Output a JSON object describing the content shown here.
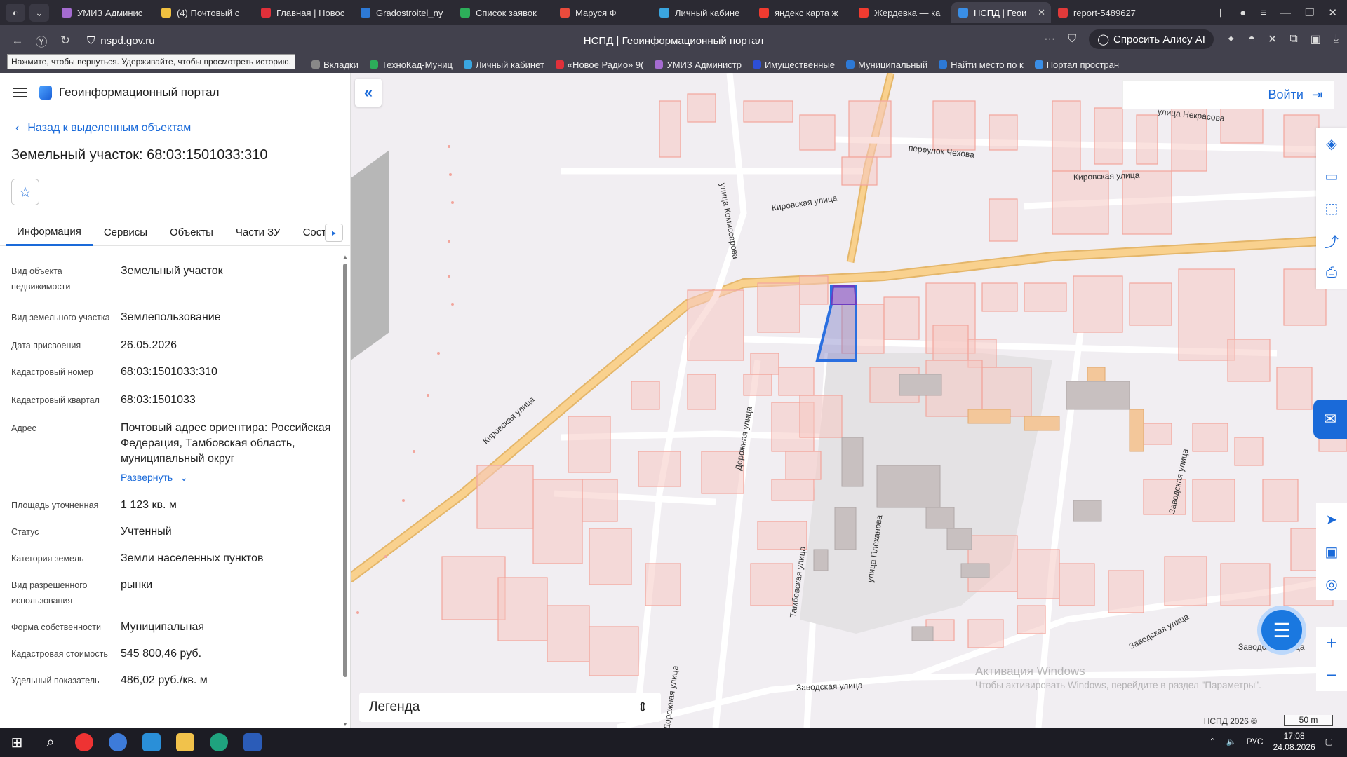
{
  "browser": {
    "tabs": [
      {
        "title": "УМИЗ Админис",
        "color": "#a46bd0",
        "active": false
      },
      {
        "title": "(4) Почтовый с",
        "color": "#f0c040",
        "active": false
      },
      {
        "title": "Главная | Новос",
        "color": "#e0303a",
        "active": false
      },
      {
        "title": "Gradostroitel_ny",
        "color": "#2d79d6",
        "active": false
      },
      {
        "title": "Список заявок",
        "color": "#2dae5a",
        "active": false
      },
      {
        "title": "Маруся Ф",
        "color": "#e94b3c",
        "active": false
      },
      {
        "title": "Личный кабине",
        "color": "#3aa6e0",
        "active": false
      },
      {
        "title": "яндекс карта ж",
        "color": "#f03b30",
        "active": false
      },
      {
        "title": "Жердевка — ка",
        "color": "#f03b30",
        "active": false
      },
      {
        "title": "НСПД | Геои",
        "color": "#3a8ee6",
        "active": true
      },
      {
        "title": "report-5489627",
        "color": "#e03a3a",
        "active": false
      }
    ],
    "url": "nspd.gov.ru",
    "page_title": "НСПД | Геоинформационный портал",
    "alice_label": "Спросить Алису AI",
    "tooltip": "Нажмите, чтобы вернуться. Удерживайте, чтобы просмотреть историю.",
    "bookmarks": [
      {
        "label": "Вкладки",
        "color": "#888"
      },
      {
        "label": "ТехноКад-Муниц",
        "color": "#2dae5a"
      },
      {
        "label": "Личный кабинет",
        "color": "#3aa6e0"
      },
      {
        "label": "«Новое Радио» 9(",
        "color": "#e0303a"
      },
      {
        "label": "УМИЗ Администр",
        "color": "#a46bd0"
      },
      {
        "label": "Имущественные",
        "color": "#2d4fd6"
      },
      {
        "label": "Муниципальный",
        "color": "#2d79d6"
      },
      {
        "label": "Найти место по к",
        "color": "#2d79d6"
      },
      {
        "label": "Портал простран",
        "color": "#3a8ee6"
      }
    ]
  },
  "panel": {
    "portal_name": "Геоинформационный портал",
    "back_label": "Назад к выделенным объектам",
    "object_title": "Земельный участок: 68:03:1501033:310",
    "tabs": [
      "Информация",
      "Сервисы",
      "Объекты",
      "Части ЗУ",
      "Состав"
    ],
    "properties": [
      {
        "label": "Вид объекта недвижимости",
        "value": "Земельный участок"
      },
      {
        "label": "Вид земельного участка",
        "value": "Землепользование"
      },
      {
        "label": "Дата присвоения",
        "value": "26.05.2026"
      },
      {
        "label": "Кадастровый номер",
        "value": "68:03:1501033:310"
      },
      {
        "label": "Кадастровый квартал",
        "value": "68:03:1501033"
      },
      {
        "label": "Адрес",
        "value": "Почтовый адрес ориентира: Российская Федерация, Тамбовская область, муниципальный округ",
        "expand": "Развернуть"
      },
      {
        "label": "Площадь уточненная",
        "value": "1 123 кв. м"
      },
      {
        "label": "Статус",
        "value": "Учтенный"
      },
      {
        "label": "Категория земель",
        "value": "Земли населенных пунктов"
      },
      {
        "label": "Вид разрешенного использования",
        "value": "рынки"
      },
      {
        "label": "Форма собственности",
        "value": "Муниципальная"
      },
      {
        "label": "Кадастровая стоимость",
        "value": "545 800,46 руб."
      },
      {
        "label": "Удельный показатель",
        "value": "486,02 руб./кв. м"
      }
    ]
  },
  "map": {
    "login_label": "Войти",
    "legend_label": "Легенда",
    "copyright": "НСПД 2026 ©",
    "scale_label": "50 m",
    "watermark_title": "Активация Windows",
    "watermark_sub": "Чтобы активировать Windows, перейдите в раздел \"Параметры\".",
    "street_labels": [
      "Кировская улица",
      "Кировская улица",
      "Кировская улица",
      "улица Некрасова",
      "переулок Чехова",
      "улица Комиссарова",
      "Дорожная улица",
      "Тамбовская улица",
      "улица Плеханова",
      "Заводская улица",
      "Заводская улица",
      "Заводская улица",
      "Дорожная улица",
      "Заводская улица"
    ],
    "colors": {
      "parcel": "#f2a59c",
      "parcel_fill": "rgba(246,200,194,0.55)",
      "road": "#f6c97a",
      "selected": "#2a6fe0"
    }
  },
  "taskbar": {
    "language": "РУС",
    "time": "17:08",
    "date": "24.08.2026"
  }
}
